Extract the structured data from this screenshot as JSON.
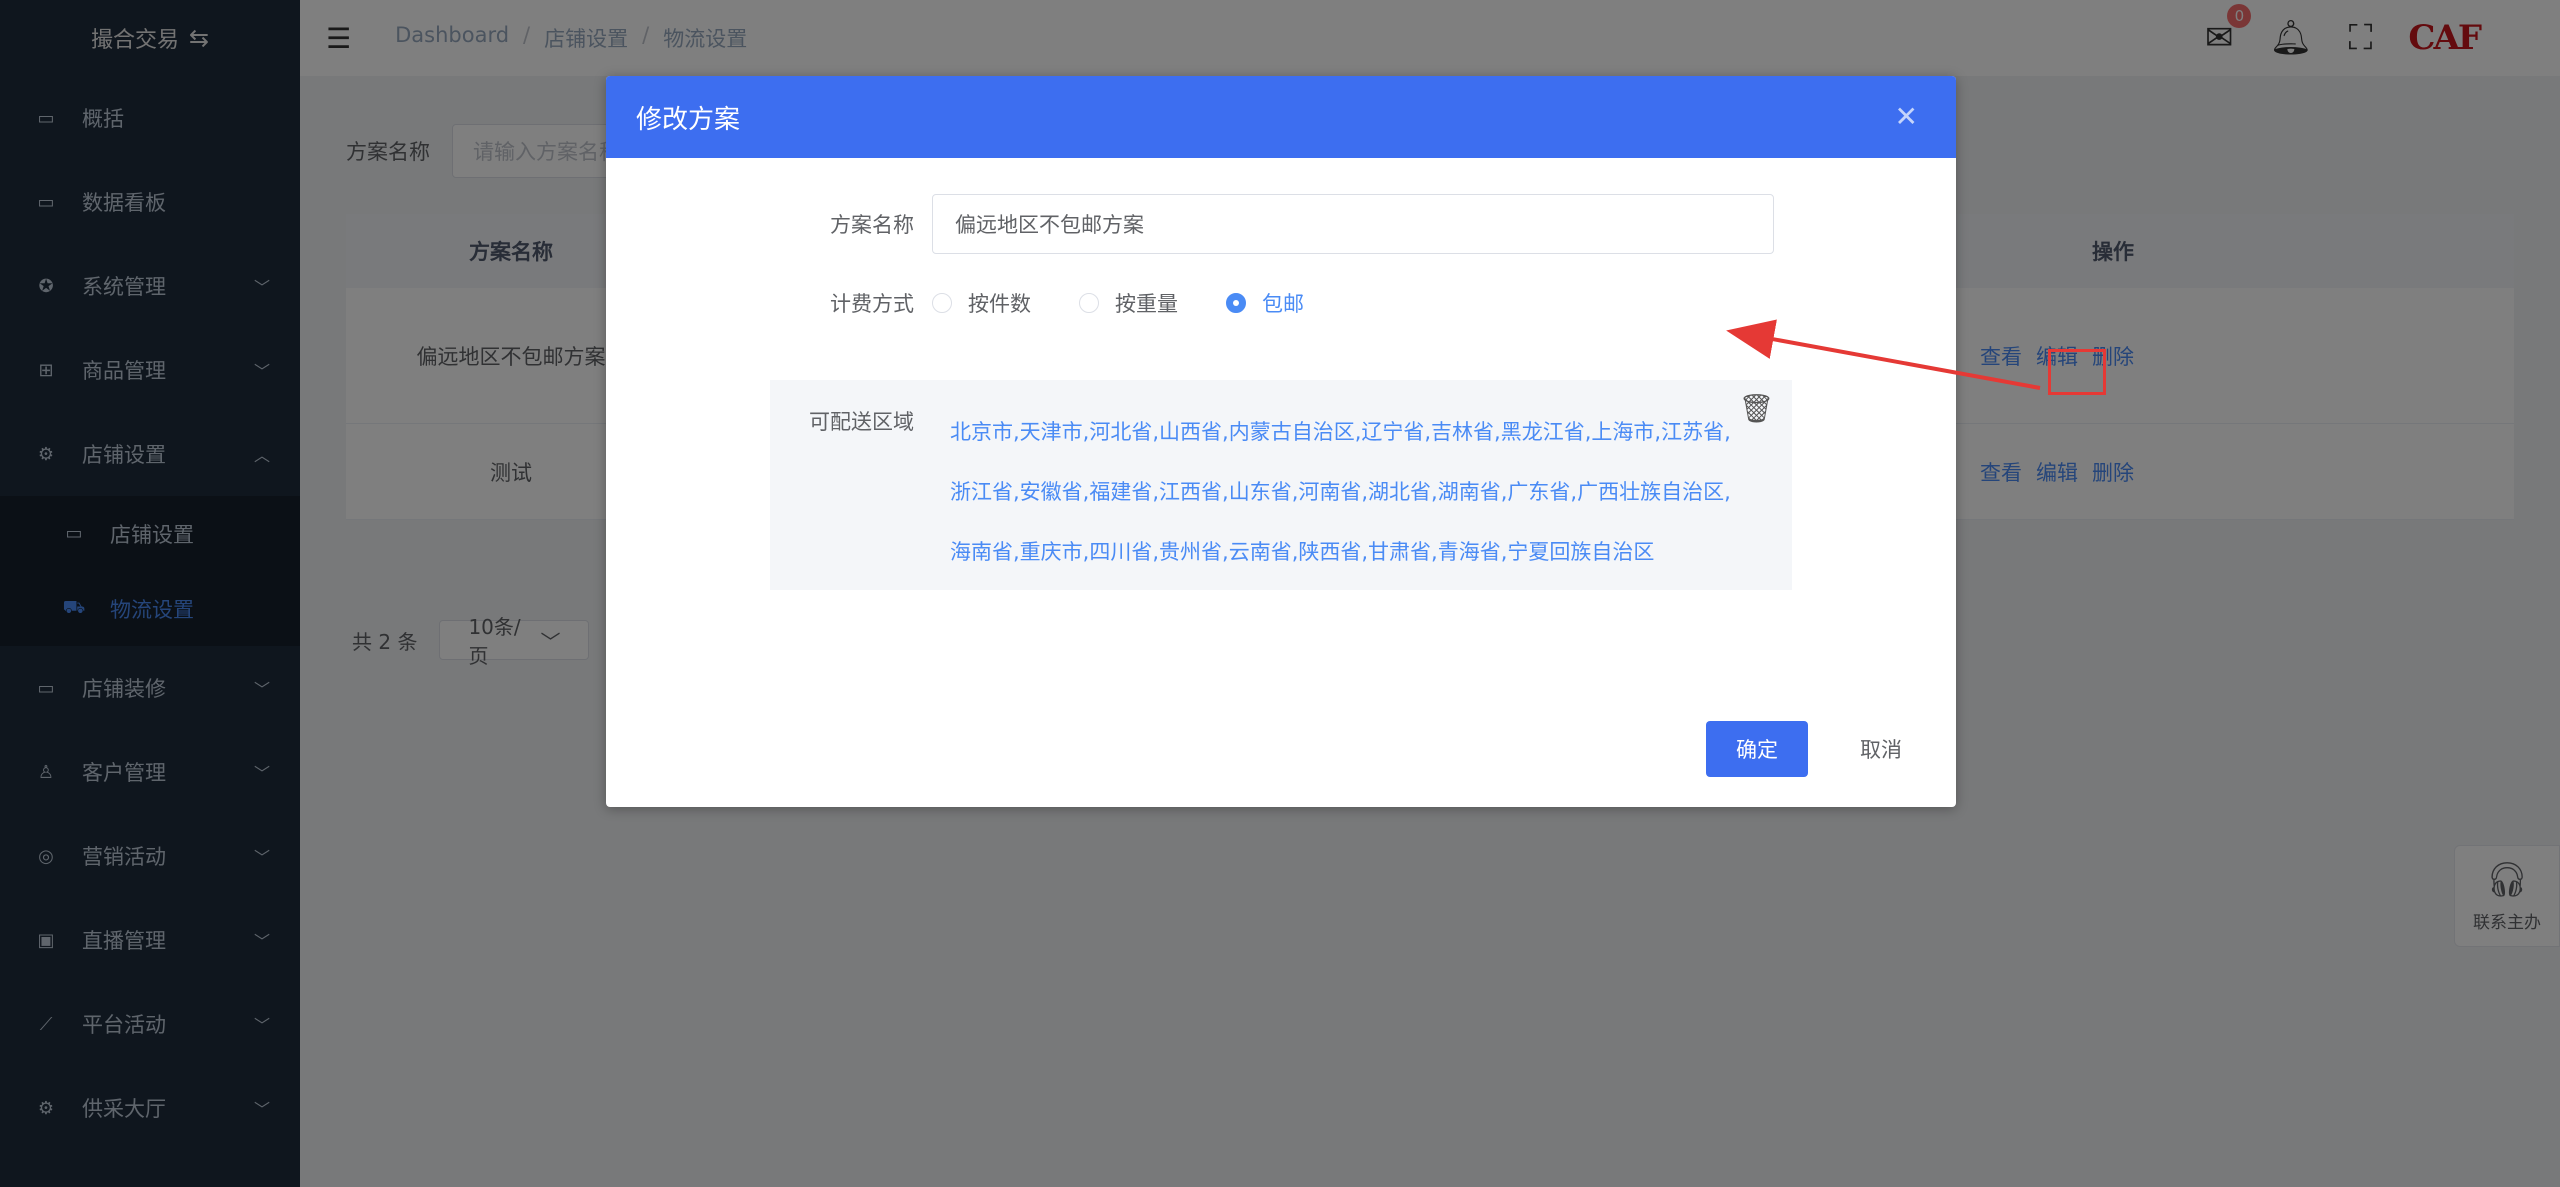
{
  "sidebar": {
    "brand": "撮合交易",
    "items": [
      {
        "label": "概括",
        "icon": "monitor-icon"
      },
      {
        "label": "数据看板",
        "icon": "monitor-icon"
      },
      {
        "label": "系统管理",
        "icon": "gear-icon"
      },
      {
        "label": "商品管理",
        "icon": "grid-icon"
      },
      {
        "label": "店铺设置",
        "icon": "settings-icon"
      },
      {
        "label": "店铺装修",
        "icon": "monitor-icon"
      },
      {
        "label": "客户管理",
        "icon": "user-icon"
      },
      {
        "label": "营销活动",
        "icon": "compass-icon"
      },
      {
        "label": "直播管理",
        "icon": "video-icon"
      },
      {
        "label": "平台活动",
        "icon": "chart-icon"
      },
      {
        "label": "供采大厅",
        "icon": "settings-icon"
      }
    ],
    "submenu": [
      {
        "label": "店铺设置"
      },
      {
        "label": "物流设置"
      }
    ]
  },
  "header": {
    "breadcrumb": [
      "Dashboard",
      "店铺设置",
      "物流设置"
    ],
    "mail_badge": "0",
    "logo": "CAF"
  },
  "main": {
    "filter_label": "方案名称",
    "filter_placeholder": "请输入方案名称",
    "table": {
      "col_name": "方案名称",
      "col_op": "操作",
      "rows": [
        {
          "name": "偏远地区不包邮方案"
        },
        {
          "name": "测试"
        }
      ],
      "ops": {
        "view": "查看",
        "edit": "编辑",
        "delete": "删除"
      }
    },
    "pager": {
      "total": "共 2 条",
      "size": "10条/页"
    }
  },
  "help": {
    "label": "联系主办"
  },
  "dialog": {
    "title": "修改方案",
    "name_label": "方案名称",
    "name_value": "偏远地区不包邮方案",
    "billing_label": "计费方式",
    "billing_options": [
      "按件数",
      "按重量",
      "包邮"
    ],
    "billing_selected": "包邮",
    "region_label": "可配送区域",
    "region_text": "北京市,天津市,河北省,山西省,内蒙古自治区,辽宁省,吉林省,黑龙江省,上海市,江苏省,浙江省,安徽省,福建省,江西省,山东省,河南省,湖北省,湖南省,广东省,广西壮族自治区,海南省,重庆市,四川省,贵州省,云南省,陕西省,甘肃省,青海省,宁夏回族自治区",
    "ok": "确定",
    "cancel": "取消"
  },
  "colors": {
    "primary": "#3d6ef0",
    "link": "#4a8bf5",
    "sidebar": "#1f2d3d",
    "annotation": "#e53935"
  }
}
